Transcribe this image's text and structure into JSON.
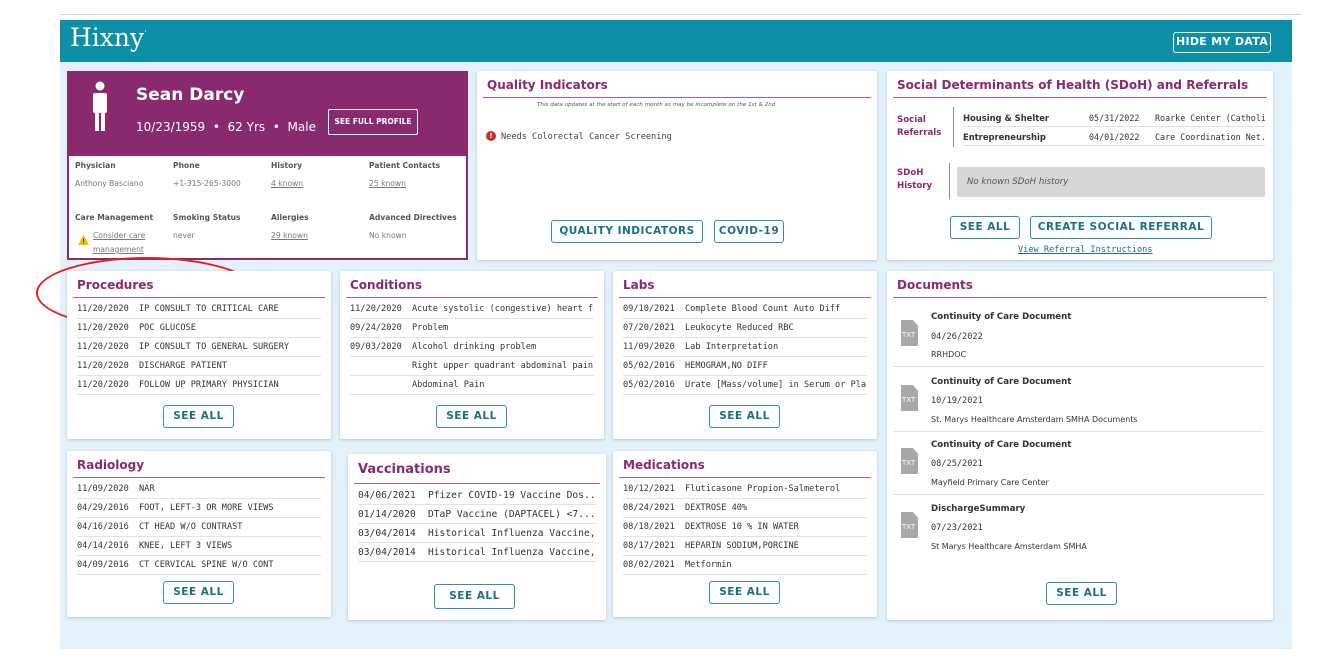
{
  "header": {
    "logo": "Hixny",
    "hide_button": "HIDE MY DATA"
  },
  "patient": {
    "name": "Sean Darcy",
    "dob": "10/23/1959",
    "age": "62 Yrs",
    "sex": "Male",
    "full_profile_button": "SEE FULL PROFILE",
    "fields": {
      "physician_label": "Physician",
      "physician": "Anthony Basciano",
      "phone_label": "Phone",
      "phone": "+1-315-265-3000",
      "history_label": "History",
      "history": "4 known",
      "contacts_label": "Patient Contacts",
      "contacts": "25 known",
      "care_label": "Care Management",
      "care_line1": "Consider care",
      "care_line2": "management",
      "smoking_label": "Smoking Status",
      "smoking": "never",
      "allergies_label": "Allergies",
      "allergies": "29 known",
      "directives_label": "Advanced Directives",
      "directives": "No known"
    },
    "colors": {
      "brand": "#8a2a6e",
      "warning": "#f0c000",
      "highlight": "#e02020"
    }
  },
  "quality": {
    "title": "Quality Indicators",
    "note": "This data updates at the start of each month so may be incomplete on the 1st & 2nd",
    "item": "Needs Colorectal Cancer Screening",
    "button_quality": "QUALITY INDICATORS",
    "button_covid": "COVID-19"
  },
  "sdoh": {
    "title": "Social Determinants of Health (SDoH) and Referrals",
    "referrals_label_1": "Social",
    "referrals_label_2": "Referrals",
    "referrals": [
      {
        "type": "Housing & Shelter",
        "date": "05/31/2022",
        "org": "Roarke Center (Catholi..."
      },
      {
        "type": "Entrepreneurship",
        "date": "04/01/2022",
        "org": "Care Coordination Net..."
      }
    ],
    "history_label_1": "SDoH",
    "history_label_2": "History",
    "history_none": "No known SDoH history",
    "see_all": "SEE ALL",
    "create": "CREATE SOCIAL REFERRAL",
    "instructions_link": "View Referral Instructions"
  },
  "procedures": {
    "title": "Procedures",
    "rows": [
      {
        "date": "11/20/2020",
        "text": "IP CONSULT TO CRITICAL CARE"
      },
      {
        "date": "11/20/2020",
        "text": "POC GLUCOSE"
      },
      {
        "date": "11/20/2020",
        "text": "IP CONSULT TO GENERAL SURGERY"
      },
      {
        "date": "11/20/2020",
        "text": "DISCHARGE PATIENT"
      },
      {
        "date": "11/20/2020",
        "text": "FOLLOW UP PRIMARY PHYSICIAN"
      }
    ],
    "see_all": "SEE ALL"
  },
  "conditions": {
    "title": "Conditions",
    "rows": [
      {
        "date": "11/20/2020",
        "text": "Acute systolic (congestive) heart failure"
      },
      {
        "date": "09/24/2020",
        "text": "Problem"
      },
      {
        "date": "09/03/2020",
        "text": "Alcohol drinking problem"
      },
      {
        "date": "",
        "text": "Right upper quadrant abdominal pain"
      },
      {
        "date": "",
        "text": "Abdominal Pain"
      }
    ],
    "see_all": "SEE ALL"
  },
  "labs": {
    "title": "Labs",
    "rows": [
      {
        "date": "09/10/2021",
        "text": "Complete Blood Count Auto Diff"
      },
      {
        "date": "07/20/2021",
        "text": "Leukocyte Reduced RBC"
      },
      {
        "date": "11/09/2020",
        "text": "Lab Interpretation"
      },
      {
        "date": "05/02/2016",
        "text": "HEMOGRAM,NO DIFF"
      },
      {
        "date": "05/02/2016",
        "text": "Urate [Mass/volume] in Serum or Pla..."
      }
    ],
    "see_all": "SEE ALL"
  },
  "radiology": {
    "title": "Radiology",
    "rows": [
      {
        "date": "11/09/2020",
        "text": "NAR"
      },
      {
        "date": "04/29/2016",
        "text": "FOOT, LEFT-3 OR MORE VIEWS"
      },
      {
        "date": "04/16/2016",
        "text": "CT HEAD W/O CONTRAST"
      },
      {
        "date": "04/14/2016",
        "text": "KNEE, LEFT 3 VIEWS"
      },
      {
        "date": "04/09/2016",
        "text": "CT CERVICAL SPINE W/O CONT"
      }
    ],
    "see_all": "SEE ALL"
  },
  "vaccinations": {
    "title": "Vaccinations",
    "rows": [
      {
        "date": "04/06/2021",
        "text": "Pfizer COVID-19 Vaccine Dos..."
      },
      {
        "date": "01/14/2020",
        "text": "DTaP Vaccine (DAPTACEL) <7..."
      },
      {
        "date": "03/04/2014",
        "text": "Historical Influenza Vaccine, ..."
      },
      {
        "date": "03/04/2014",
        "text": "Historical Influenza Vaccine, ..."
      }
    ],
    "see_all": "SEE ALL"
  },
  "medications": {
    "title": "Medications",
    "rows": [
      {
        "date": "10/12/2021",
        "text": "Fluticasone Propion-Salmeterol"
      },
      {
        "date": "08/24/2021",
        "text": "DEXTROSE 40%"
      },
      {
        "date": "08/18/2021",
        "text": "DEXTROSE 10 % IN WATER"
      },
      {
        "date": "08/17/2021",
        "text": "HEPARIN SODIUM,PORCINE"
      },
      {
        "date": "08/02/2021",
        "text": "Metformin"
      }
    ],
    "see_all": "SEE ALL"
  },
  "documents": {
    "title": "Documents",
    "icon_label": "TXT",
    "items": [
      {
        "title": "Continuity of Care Document",
        "date": "04/26/2022",
        "source": "RRHDOC"
      },
      {
        "title": "Continuity of Care Document",
        "date": "10/19/2021",
        "source": "St. Marys Healthcare Amsterdam SMHA Documents"
      },
      {
        "title": "Continuity of Care Document",
        "date": "08/25/2021",
        "source": "Mayfield Primary Care Center"
      },
      {
        "title": "DischargeSummary",
        "date": "07/23/2021",
        "source": "St Marys Healthcare Amsterdam SMHA"
      }
    ],
    "see_all": "SEE ALL"
  }
}
